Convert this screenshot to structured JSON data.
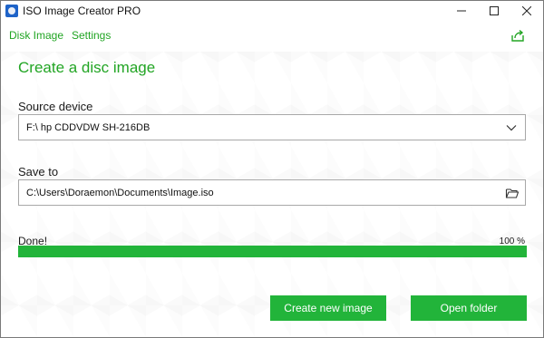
{
  "window": {
    "title": "ISO Image Creator PRO"
  },
  "menu": {
    "items": [
      "Disk Image",
      "Settings"
    ]
  },
  "icons": {
    "app": "disc-app-icon",
    "share": "share-icon",
    "chevron": "chevron-down-icon",
    "folder": "folder-open-icon",
    "minimize": "minimize-icon",
    "maximize": "maximize-icon",
    "close": "close-icon"
  },
  "page": {
    "heading": "Create a disc image"
  },
  "source": {
    "label": "Source device",
    "value": "F:\\ hp CDDVDW SH-216DB"
  },
  "save": {
    "label": "Save to",
    "value": "C:\\Users\\Doraemon\\Documents\\Image.iso"
  },
  "progress": {
    "status": "Done!",
    "percent_text": "100 %",
    "fraction": 1.0
  },
  "buttons": {
    "create_new": "Create new image",
    "open_folder": "Open folder"
  },
  "colors": {
    "accent": "#22b43a",
    "accent_text": "#22a524",
    "track": "#e2e2e2"
  }
}
